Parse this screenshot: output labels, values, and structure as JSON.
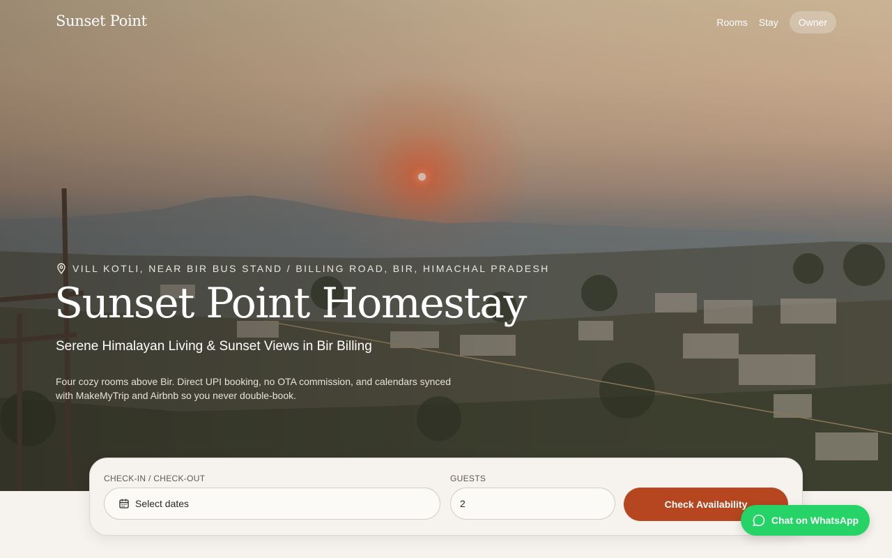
{
  "nav": {
    "logo": "Sunset Point",
    "links": [
      "Rooms",
      "Stay"
    ],
    "owner": "Owner"
  },
  "hero": {
    "location": "VILL KOTLI, NEAR BIR BUS STAND / BILLING ROAD, BIR, HIMACHAL PRADESH",
    "title": "Sunset Point Homestay",
    "subtitle": "Serene Himalayan Living & Sunset Views in Bir Billing",
    "description": "Four cozy rooms above Bir. Direct UPI booking, no OTA commission, and calendars synced with MakeMyTrip and Airbnb so you never double-book."
  },
  "booking": {
    "dates_label": "CHECK-IN / CHECK-OUT",
    "dates_value": "Select dates",
    "guests_label": "GUESTS",
    "guests_value": "2",
    "submit": "Check Availability"
  },
  "whatsapp": {
    "label": "Chat on WhatsApp"
  },
  "colors": {
    "accent": "#b5461f",
    "whatsapp": "#25d366",
    "page_background": "#f6f3ee"
  },
  "icons": {
    "location": "map-pin-icon",
    "calendar": "calendar-icon",
    "whatsapp": "chat-bubble-icon"
  }
}
